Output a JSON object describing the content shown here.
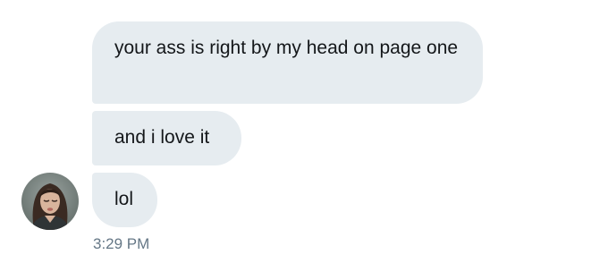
{
  "conversation": {
    "messages": [
      {
        "text": "your ass is right by my head on page one"
      },
      {
        "text": "and i love it"
      },
      {
        "text": "lol"
      }
    ],
    "timestamp": "3:29 PM",
    "sender_avatar": {
      "icon": "profile-photo-avatar"
    }
  },
  "colors": {
    "bubble_background": "#e6ecf0",
    "message_text": "#14171a",
    "timestamp_text": "#657786",
    "page_background": "#ffffff"
  }
}
